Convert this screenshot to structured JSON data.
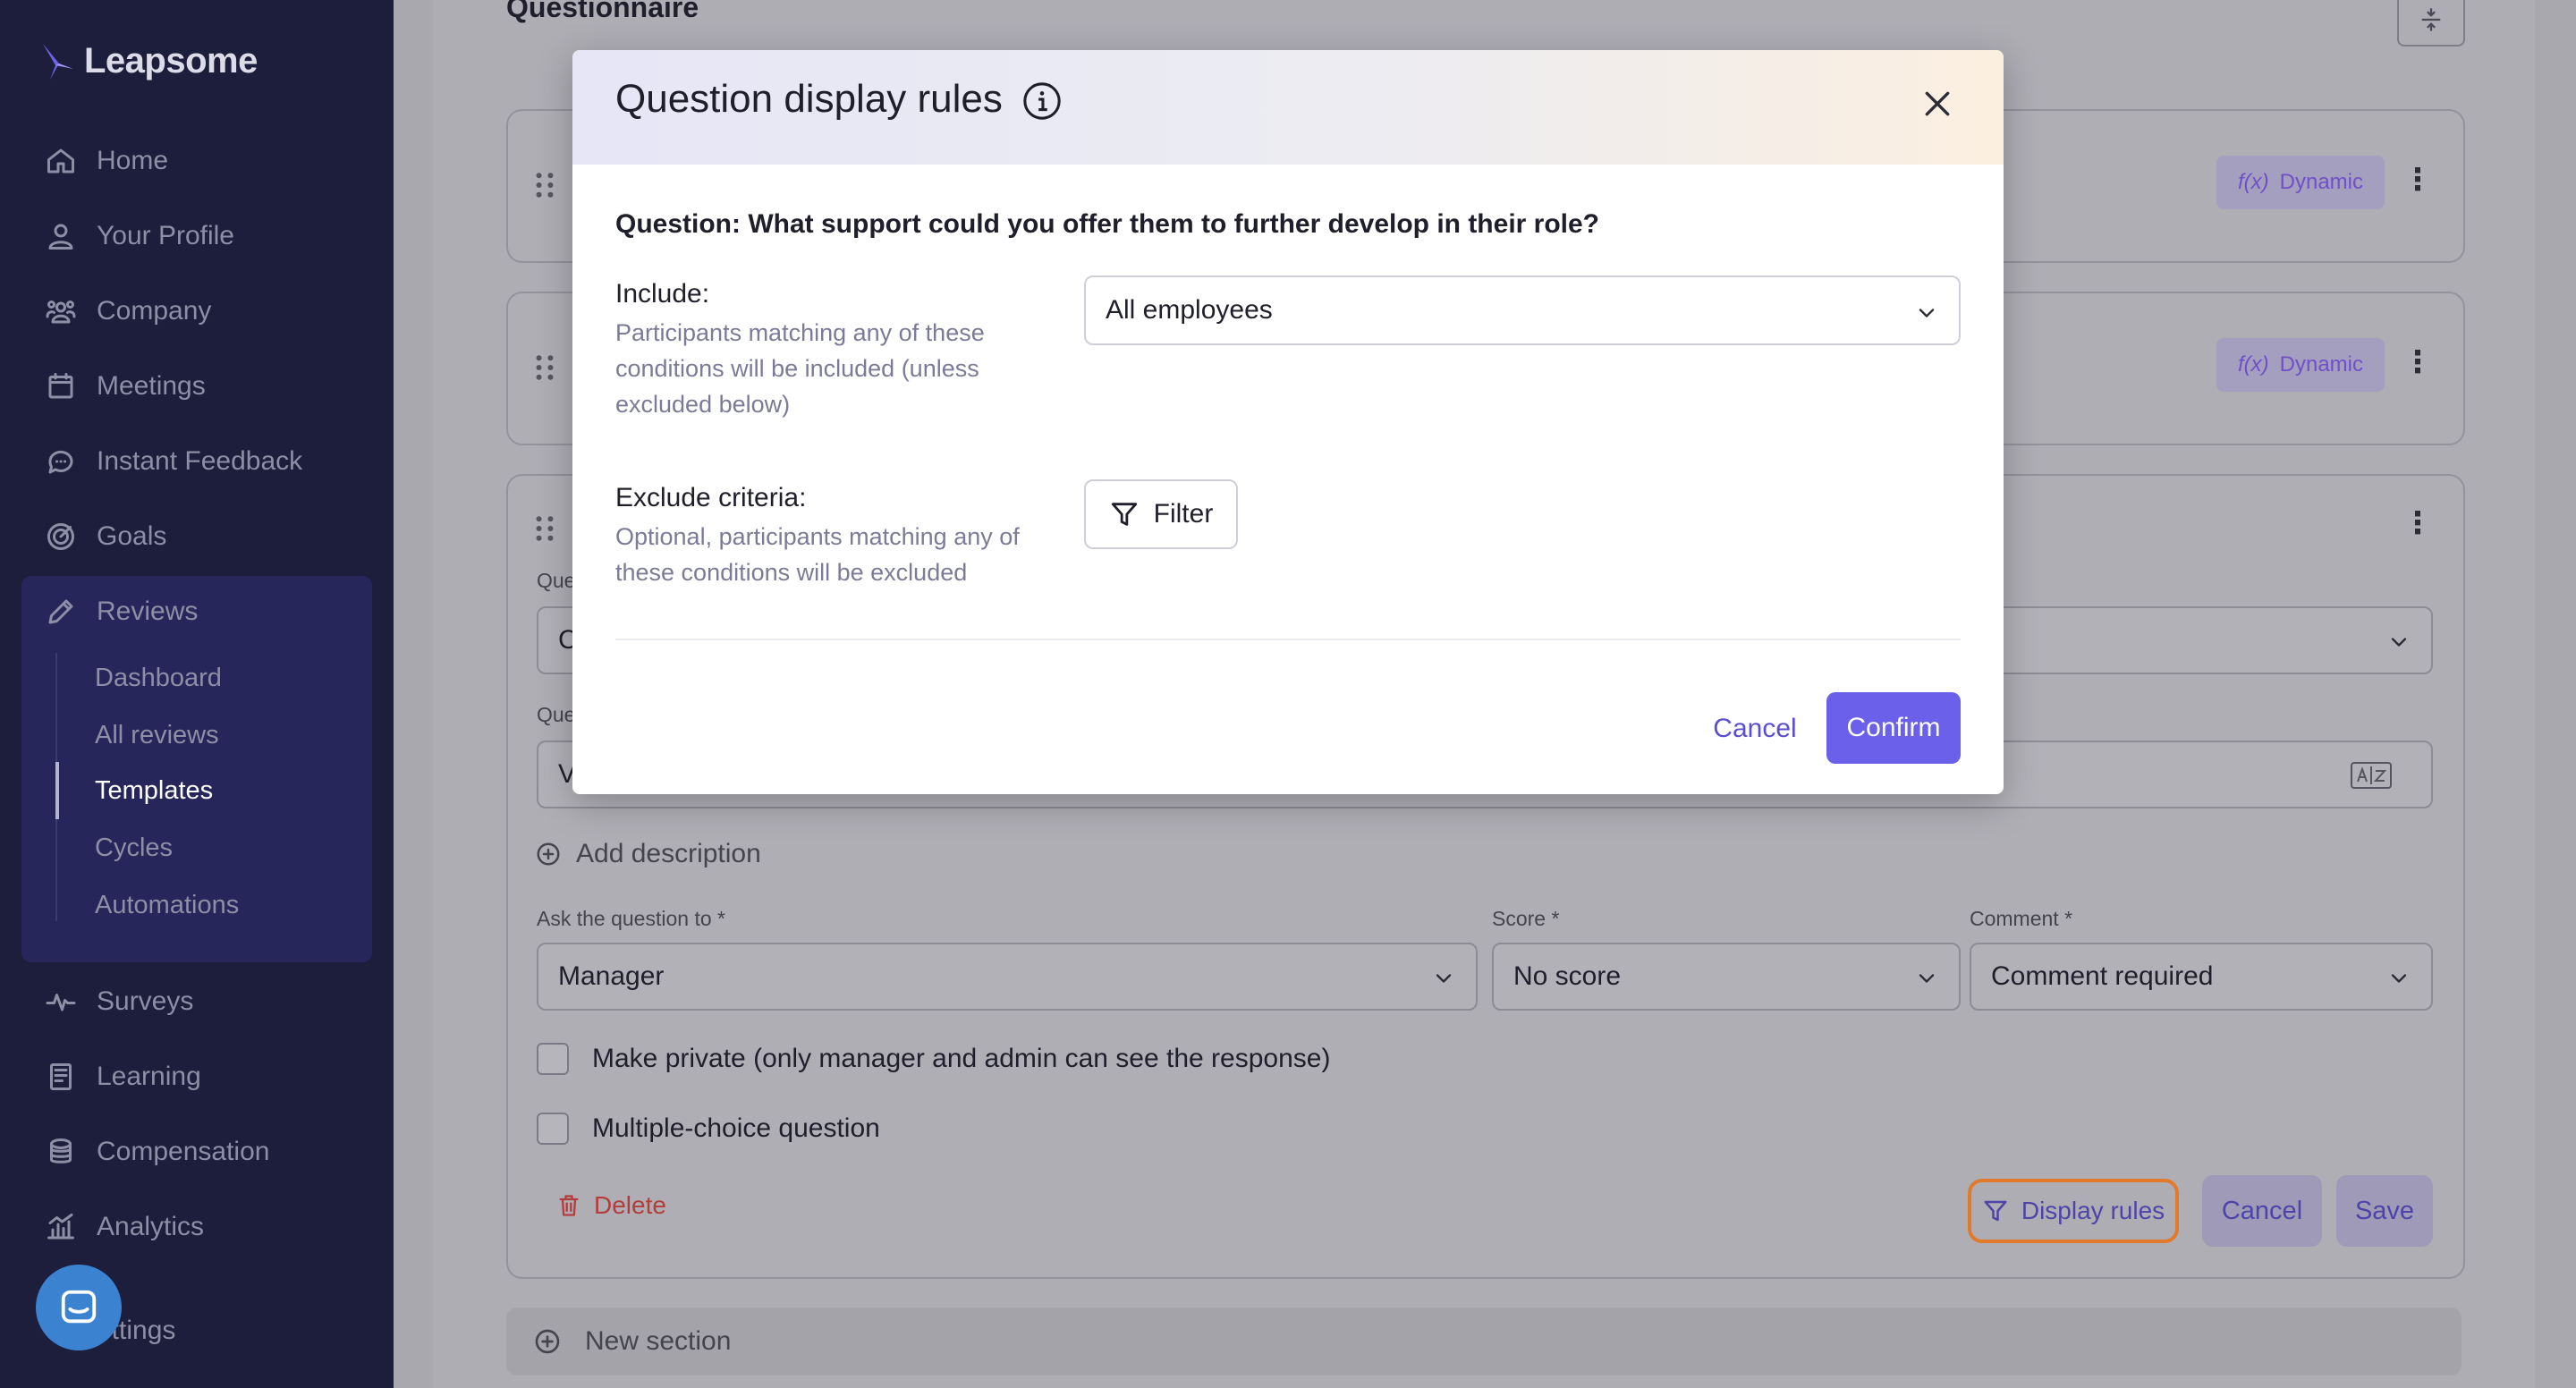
{
  "sidebar": {
    "logo_text": "Leapsome",
    "items": [
      {
        "label": "Home",
        "icon": "home-icon"
      },
      {
        "label": "Your Profile",
        "icon": "user-icon"
      },
      {
        "label": "Company",
        "icon": "users-icon"
      },
      {
        "label": "Meetings",
        "icon": "calendar-icon"
      },
      {
        "label": "Instant Feedback",
        "icon": "chat-icon"
      },
      {
        "label": "Goals",
        "icon": "target-icon"
      },
      {
        "label": "Reviews",
        "icon": "pencil-icon"
      }
    ],
    "reviews_sub": [
      "Dashboard",
      "All reviews",
      "Templates",
      "Cycles",
      "Automations"
    ],
    "active_sub": "Templates",
    "items_after": [
      {
        "label": "Surveys",
        "icon": "pulse-icon"
      },
      {
        "label": "Learning",
        "icon": "book-icon"
      },
      {
        "label": "Compensation",
        "icon": "coins-icon"
      },
      {
        "label": "Analytics",
        "icon": "chart-icon"
      },
      {
        "label": "ettings",
        "icon": "settings-icon"
      }
    ]
  },
  "main": {
    "title": "Questionnaire",
    "dynamic_label": "Dynamic",
    "dynamic_fx": "f(x)",
    "question_label_cut": "Que",
    "question_text_cut": "Que",
    "select_value_cut": "C",
    "text_value_cut": "V",
    "add_description": "Add description",
    "ask_label": "Ask the question to *",
    "ask_value": "Manager",
    "score_label": "Score *",
    "score_value": "No score",
    "comment_label": "Comment *",
    "comment_value": "Comment required",
    "private_checkbox": "Make private (only manager and admin can see the response)",
    "multiple_checkbox": "Multiple-choice question",
    "delete_label": "Delete",
    "display_rules_label": "Display rules",
    "cancel_label": "Cancel",
    "save_label": "Save",
    "new_section_label": "New section"
  },
  "modal": {
    "title": "Question display rules",
    "question": "Question: What support could you offer them to further develop in their role?",
    "include_label": "Include:",
    "include_help": "Participants matching any of these conditions will be included (unless excluded below)",
    "include_value": "All employees",
    "exclude_label": "Exclude criteria:",
    "exclude_help": "Optional, participants matching any of these conditions will be excluded",
    "filter_label": "Filter",
    "cancel_label": "Cancel",
    "confirm_label": "Confirm"
  },
  "colors": {
    "sidebar_bg": "#1d1d3c",
    "accent": "#6a60ea",
    "highlight": "#e27a2c",
    "danger": "#b33d3d"
  }
}
